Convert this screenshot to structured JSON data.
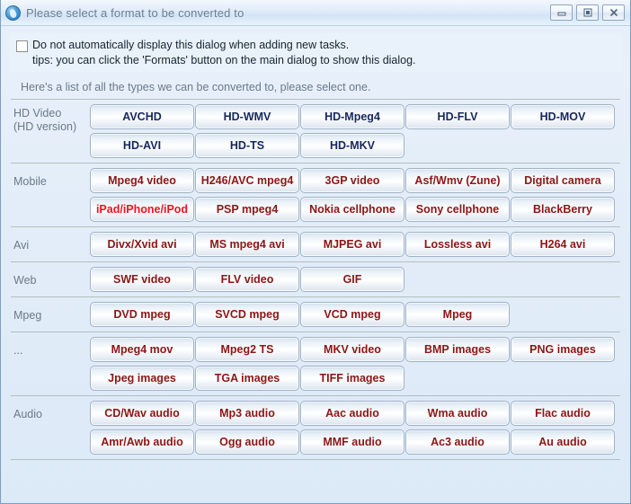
{
  "window": {
    "title": "Please select a format to be converted to",
    "icon": "media-globe-icon",
    "controls": [
      {
        "name": "minimize",
        "glyph": "minimize-icon"
      },
      {
        "name": "maximize",
        "glyph": "maximize-icon"
      },
      {
        "name": "close",
        "glyph": "close-icon"
      }
    ]
  },
  "options": {
    "checkbox_checked": false,
    "checkbox_line1": "Do not automatically display this dialog when adding new tasks.",
    "checkbox_line2": "tips: you can click the 'Formats' button on the main dialog to show this dialog."
  },
  "hint": "Here's a list of all the types we can be converted to, please select one.",
  "colors": {
    "hd_text": "#16275c",
    "default_text": "#8c1515",
    "highlight_text": "#f01020",
    "dialog_bg": "#dce9f7",
    "title_text": "#6d7f93",
    "label_text": "#6b7a88",
    "rule": "#9aa99a"
  },
  "categories": [
    {
      "label": "HD Video\n(HD version)",
      "two_line": true,
      "buttons": [
        {
          "label": "AVCHD",
          "style": "hd"
        },
        {
          "label": "HD-WMV",
          "style": "hd"
        },
        {
          "label": "HD-Mpeg4",
          "style": "hd"
        },
        {
          "label": "HD-FLV",
          "style": "hd"
        },
        {
          "label": "HD-MOV",
          "style": "hd"
        },
        {
          "label": "HD-AVI",
          "style": "hd"
        },
        {
          "label": "HD-TS",
          "style": "hd"
        },
        {
          "label": "HD-MKV",
          "style": "hd"
        }
      ]
    },
    {
      "label": "Mobile",
      "two_line": false,
      "buttons": [
        {
          "label": "Mpeg4 video",
          "style": "normal"
        },
        {
          "label": "H246/AVC mpeg4",
          "style": "normal"
        },
        {
          "label": "3GP video",
          "style": "normal"
        },
        {
          "label": "Asf/Wmv (Zune)",
          "style": "normal"
        },
        {
          "label": "Digital camera",
          "style": "normal"
        },
        {
          "label": "iPad/iPhone/iPod",
          "style": "hot"
        },
        {
          "label": "PSP mpeg4",
          "style": "normal"
        },
        {
          "label": "Nokia cellphone",
          "style": "normal"
        },
        {
          "label": "Sony cellphone",
          "style": "normal"
        },
        {
          "label": "BlackBerry",
          "style": "normal"
        }
      ]
    },
    {
      "label": "Avi",
      "two_line": false,
      "buttons": [
        {
          "label": "Divx/Xvid avi",
          "style": "normal"
        },
        {
          "label": "MS mpeg4 avi",
          "style": "normal"
        },
        {
          "label": "MJPEG avi",
          "style": "normal"
        },
        {
          "label": "Lossless avi",
          "style": "normal"
        },
        {
          "label": "H264 avi",
          "style": "normal"
        }
      ]
    },
    {
      "label": "Web",
      "two_line": false,
      "buttons": [
        {
          "label": "SWF video",
          "style": "normal"
        },
        {
          "label": "FLV video",
          "style": "normal"
        },
        {
          "label": "GIF",
          "style": "normal"
        }
      ]
    },
    {
      "label": "Mpeg",
      "two_line": false,
      "buttons": [
        {
          "label": "DVD mpeg",
          "style": "normal"
        },
        {
          "label": "SVCD mpeg",
          "style": "normal"
        },
        {
          "label": "VCD mpeg",
          "style": "normal"
        },
        {
          "label": "Mpeg",
          "style": "normal"
        }
      ]
    },
    {
      "label": "...",
      "two_line": false,
      "buttons": [
        {
          "label": "Mpeg4 mov",
          "style": "normal"
        },
        {
          "label": "Mpeg2 TS",
          "style": "normal"
        },
        {
          "label": "MKV video",
          "style": "normal"
        },
        {
          "label": "BMP images",
          "style": "normal"
        },
        {
          "label": "PNG images",
          "style": "normal"
        },
        {
          "label": "Jpeg images",
          "style": "normal"
        },
        {
          "label": "TGA images",
          "style": "normal"
        },
        {
          "label": "TIFF images",
          "style": "normal"
        }
      ]
    },
    {
      "label": "Audio",
      "two_line": false,
      "buttons": [
        {
          "label": "CD/Wav audio",
          "style": "normal"
        },
        {
          "label": "Mp3 audio",
          "style": "normal"
        },
        {
          "label": "Aac audio",
          "style": "normal"
        },
        {
          "label": "Wma audio",
          "style": "normal"
        },
        {
          "label": "Flac audio",
          "style": "normal"
        },
        {
          "label": "Amr/Awb audio",
          "style": "normal"
        },
        {
          "label": "Ogg audio",
          "style": "normal"
        },
        {
          "label": "MMF audio",
          "style": "normal"
        },
        {
          "label": "Ac3 audio",
          "style": "normal"
        },
        {
          "label": "Au audio",
          "style": "normal"
        }
      ]
    }
  ]
}
